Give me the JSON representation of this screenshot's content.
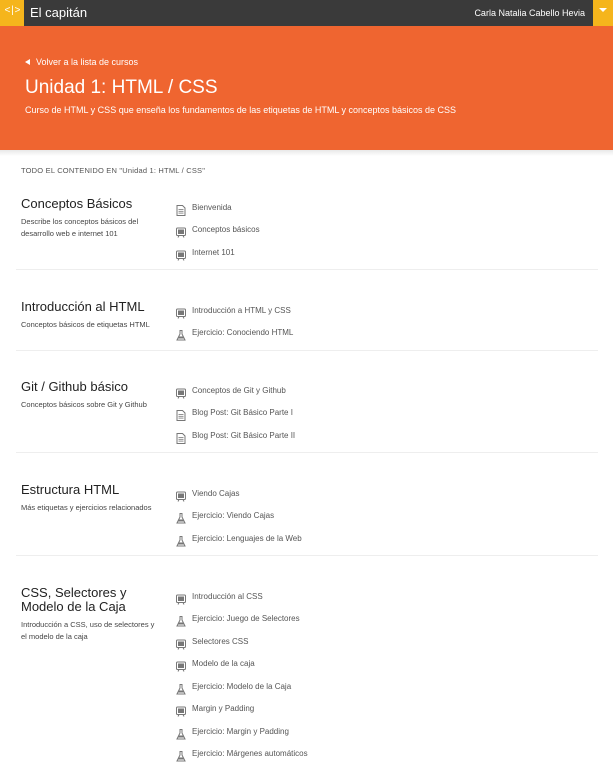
{
  "topbar": {
    "logo": "<|>",
    "app_title": "El capitán",
    "user_name": "Carla Natalia Cabello Hevia"
  },
  "hero": {
    "back_label": "Volver a la lista de cursos",
    "title": "Unidad 1: HTML / CSS",
    "subtitle": "Curso de HTML y CSS que enseña los fundamentos de las etiquetas de HTML y conceptos básicos de CSS"
  },
  "content_header": "TODO EL CONTENIDO EN \"Unidad 1: HTML / CSS\"",
  "colors": {
    "accent": "#ef6530",
    "topbar": "#3a3a3a",
    "logo_bg": "#f5b51c"
  },
  "sections": [
    {
      "title": "Conceptos Básicos",
      "description": "Describe los conceptos básicos del desarrollo web e internet 101",
      "items": [
        {
          "icon": "document-icon",
          "label": "Bienvenida"
        },
        {
          "icon": "video-icon",
          "label": "Conceptos básicos"
        },
        {
          "icon": "video-icon",
          "label": "Internet 101"
        }
      ]
    },
    {
      "title": "Introducción al HTML",
      "description": "Conceptos básicos de etiquetas HTML",
      "items": [
        {
          "icon": "video-icon",
          "label": "Introducción a HTML y CSS"
        },
        {
          "icon": "flask-icon",
          "label": "Ejercicio: Conociendo HTML"
        }
      ]
    },
    {
      "title": "Git / Github básico",
      "description": "Conceptos básicos sobre Git y Github",
      "items": [
        {
          "icon": "video-icon",
          "label": "Conceptos de Git y Github"
        },
        {
          "icon": "document-icon",
          "label": "Blog Post: Git Básico Parte I"
        },
        {
          "icon": "document-icon",
          "label": "Blog Post: Git Básico Parte II"
        }
      ]
    },
    {
      "title": "Estructura HTML",
      "description": "Más etiquetas y ejercicios relacionados",
      "items": [
        {
          "icon": "video-icon",
          "label": "Viendo Cajas"
        },
        {
          "icon": "flask-icon",
          "label": "Ejercicio: Viendo Cajas"
        },
        {
          "icon": "flask-icon",
          "label": "Ejercicio: Lenguajes de la Web"
        }
      ]
    },
    {
      "title": "CSS, Selectores y Modelo de la Caja",
      "description": "Introducción a CSS, uso de selectores y el modelo de la caja",
      "items": [
        {
          "icon": "video-icon",
          "label": "Introducción al CSS"
        },
        {
          "icon": "flask-icon",
          "label": "Ejercicio: Juego de Selectores"
        },
        {
          "icon": "video-icon",
          "label": "Selectores CSS"
        },
        {
          "icon": "video-icon",
          "label": "Modelo de la caja"
        },
        {
          "icon": "flask-icon",
          "label": "Ejercicio: Modelo de la Caja"
        },
        {
          "icon": "video-icon",
          "label": "Margin y Padding"
        },
        {
          "icon": "flask-icon",
          "label": "Ejercicio: Margin y Padding"
        },
        {
          "icon": "flask-icon",
          "label": "Ejercicio: Márgenes automáticos"
        }
      ]
    }
  ]
}
